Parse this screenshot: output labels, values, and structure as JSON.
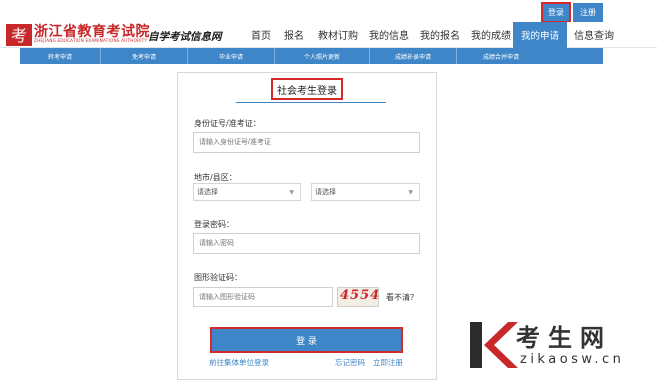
{
  "topbar": {
    "login_label": "登录",
    "register_label": "注册"
  },
  "header": {
    "logo_title": "浙江省教育考试院",
    "logo_subtitle": "ZHEJIANG EDUCATION EXAMINATIONS AUTHORITY",
    "logo_mark_text": "考",
    "site_name": "自学考试信息网",
    "nav": [
      "首页",
      "报名",
      "教材订购",
      "我的信息",
      "我的报名",
      "我的成绩"
    ],
    "nav_active": "我的申请",
    "nav_overflow": "信息查询"
  },
  "subnav": [
    "转考申请",
    "免考申请",
    "毕业申请",
    "个人照片更新",
    "成绩补录申请",
    "成绩合并申请"
  ],
  "login": {
    "tab_title": "社会考生登录",
    "id_label": "身份证号/准考证：",
    "id_placeholder": "请输入身份证号/准考证",
    "region_label": "地市/县区：",
    "city_select": "请选择",
    "district_select": "请选择",
    "password_label": "登录密码：",
    "password_placeholder": "请输入密码",
    "captcha_label": "图形验证码：",
    "captcha_placeholder": "请输入图形验证码",
    "captcha_text": "4554",
    "captcha_refresh": "看不清？",
    "submit_label": "登 录",
    "group_link": "前往集体单位登录",
    "forgot_link": "忘记密码",
    "register_link": "立即注册"
  },
  "watermark": {
    "title": "考生网",
    "url": "zikaosw.cn"
  },
  "colors": {
    "accent": "#3e86c8",
    "brand_red": "#c8282a",
    "highlight": "#d62828"
  }
}
